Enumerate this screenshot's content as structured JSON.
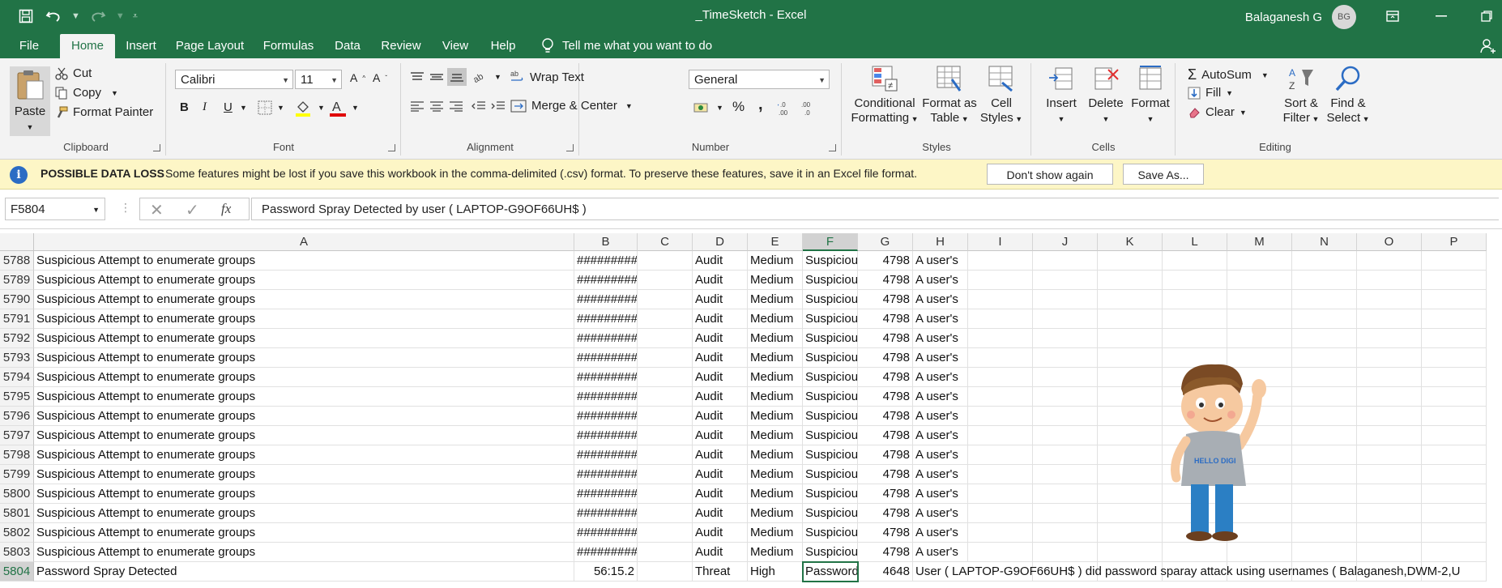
{
  "app": {
    "title": "_TimeSketch  -  Excel",
    "user_name": "Balaganesh G",
    "user_initials": "BG"
  },
  "tabs": [
    "File",
    "Home",
    "Insert",
    "Page Layout",
    "Formulas",
    "Data",
    "Review",
    "View",
    "Help"
  ],
  "active_tab": "Home",
  "tell_me": "Tell me what you want to do",
  "ribbon": {
    "clipboard": {
      "label": "Clipboard",
      "paste": "Paste",
      "cut": "Cut",
      "copy": "Copy",
      "format_painter": "Format Painter"
    },
    "font": {
      "label": "Font",
      "font_name": "Calibri",
      "font_size": "11",
      "bold": "B",
      "italic": "I",
      "underline": "U"
    },
    "alignment": {
      "label": "Alignment",
      "wrap_text": "Wrap Text",
      "merge_center": "Merge & Center"
    },
    "number": {
      "label": "Number",
      "format": "General",
      "percent": "%",
      "comma": ","
    },
    "styles": {
      "label": "Styles",
      "conditional_1": "Conditional",
      "conditional_2": "Formatting",
      "format_table_1": "Format as",
      "format_table_2": "Table",
      "cell_styles_1": "Cell",
      "cell_styles_2": "Styles"
    },
    "cells": {
      "label": "Cells",
      "insert": "Insert",
      "delete": "Delete",
      "format": "Format"
    },
    "editing": {
      "label": "Editing",
      "autosum": "AutoSum",
      "fill": "Fill",
      "clear": "Clear",
      "sort_1": "Sort &",
      "sort_2": "Filter",
      "find_1": "Find &",
      "find_2": "Select"
    }
  },
  "message_bar": {
    "title": "POSSIBLE DATA LOSS",
    "text": "Some features might be lost if you save this workbook in the comma-delimited (.csv) format. To preserve these features, save it in an Excel file format.",
    "dont_show": "Don't show again",
    "save_as": "Save As..."
  },
  "formula_bar": {
    "name_box": "F5804",
    "formula": "Password Spray Detected by user ( LAPTOP-G9OF66UH$ )",
    "fx": "fx"
  },
  "sheet": {
    "columns": [
      "A",
      "B",
      "C",
      "D",
      "E",
      "F",
      "G",
      "H",
      "I",
      "J",
      "K",
      "L",
      "M",
      "N",
      "O",
      "P"
    ],
    "selected_column": "F",
    "selected_row": "5804",
    "rows": [
      {
        "num": "5788",
        "A": "Suspicious Attempt to enumerate groups",
        "B": "#########",
        "D": "Audit",
        "E": "Medium",
        "F": "Suspicious",
        "G": "4798",
        "H": "A user's"
      },
      {
        "num": "5789",
        "A": "Suspicious Attempt to enumerate groups",
        "B": "#########",
        "D": "Audit",
        "E": "Medium",
        "F": "Suspicious",
        "G": "4798",
        "H": "A user's"
      },
      {
        "num": "5790",
        "A": "Suspicious Attempt to enumerate groups",
        "B": "#########",
        "D": "Audit",
        "E": "Medium",
        "F": "Suspicious",
        "G": "4798",
        "H": "A user's"
      },
      {
        "num": "5791",
        "A": "Suspicious Attempt to enumerate groups",
        "B": "#########",
        "D": "Audit",
        "E": "Medium",
        "F": "Suspicious",
        "G": "4798",
        "H": "A user's"
      },
      {
        "num": "5792",
        "A": "Suspicious Attempt to enumerate groups",
        "B": "#########",
        "D": "Audit",
        "E": "Medium",
        "F": "Suspicious",
        "G": "4798",
        "H": "A user's"
      },
      {
        "num": "5793",
        "A": "Suspicious Attempt to enumerate groups",
        "B": "#########",
        "D": "Audit",
        "E": "Medium",
        "F": "Suspicious",
        "G": "4798",
        "H": "A user's"
      },
      {
        "num": "5794",
        "A": "Suspicious Attempt to enumerate groups",
        "B": "#########",
        "D": "Audit",
        "E": "Medium",
        "F": "Suspicious",
        "G": "4798",
        "H": "A user's"
      },
      {
        "num": "5795",
        "A": "Suspicious Attempt to enumerate groups",
        "B": "#########",
        "D": "Audit",
        "E": "Medium",
        "F": "Suspicious",
        "G": "4798",
        "H": "A user's"
      },
      {
        "num": "5796",
        "A": "Suspicious Attempt to enumerate groups",
        "B": "#########",
        "D": "Audit",
        "E": "Medium",
        "F": "Suspicious",
        "G": "4798",
        "H": "A user's"
      },
      {
        "num": "5797",
        "A": "Suspicious Attempt to enumerate groups",
        "B": "#########",
        "D": "Audit",
        "E": "Medium",
        "F": "Suspicious",
        "G": "4798",
        "H": "A user's"
      },
      {
        "num": "5798",
        "A": "Suspicious Attempt to enumerate groups",
        "B": "#########",
        "D": "Audit",
        "E": "Medium",
        "F": "Suspicious",
        "G": "4798",
        "H": "A user's"
      },
      {
        "num": "5799",
        "A": "Suspicious Attempt to enumerate groups",
        "B": "#########",
        "D": "Audit",
        "E": "Medium",
        "F": "Suspicious",
        "G": "4798",
        "H": "A user's"
      },
      {
        "num": "5800",
        "A": "Suspicious Attempt to enumerate groups",
        "B": "#########",
        "D": "Audit",
        "E": "Medium",
        "F": "Suspicious",
        "G": "4798",
        "H": "A user's"
      },
      {
        "num": "5801",
        "A": "Suspicious Attempt to enumerate groups",
        "B": "#########",
        "D": "Audit",
        "E": "Medium",
        "F": "Suspicious",
        "G": "4798",
        "H": "A user's"
      },
      {
        "num": "5802",
        "A": "Suspicious Attempt to enumerate groups",
        "B": "#########",
        "D": "Audit",
        "E": "Medium",
        "F": "Suspicious",
        "G": "4798",
        "H": "A user's"
      },
      {
        "num": "5803",
        "A": "Suspicious Attempt to enumerate groups",
        "B": "#########",
        "D": "Audit",
        "E": "Medium",
        "F": "Suspicious",
        "G": "4798",
        "H": "A user's"
      },
      {
        "num": "5804",
        "A": "Password Spray Detected",
        "B": "56:15.2",
        "D": "Threat",
        "E": "High",
        "F": "Password",
        "G": "4648",
        "H": "User ( LAPTOP-G9OF66UH$ ) did password sparay attack using usernames ( Balaganesh,DWM-2,U"
      }
    ]
  },
  "mascot": {
    "shirt_text": "HELLO DIGI"
  },
  "colors": {
    "excel_green": "#217346",
    "message_bar": "#fdf6c6"
  }
}
